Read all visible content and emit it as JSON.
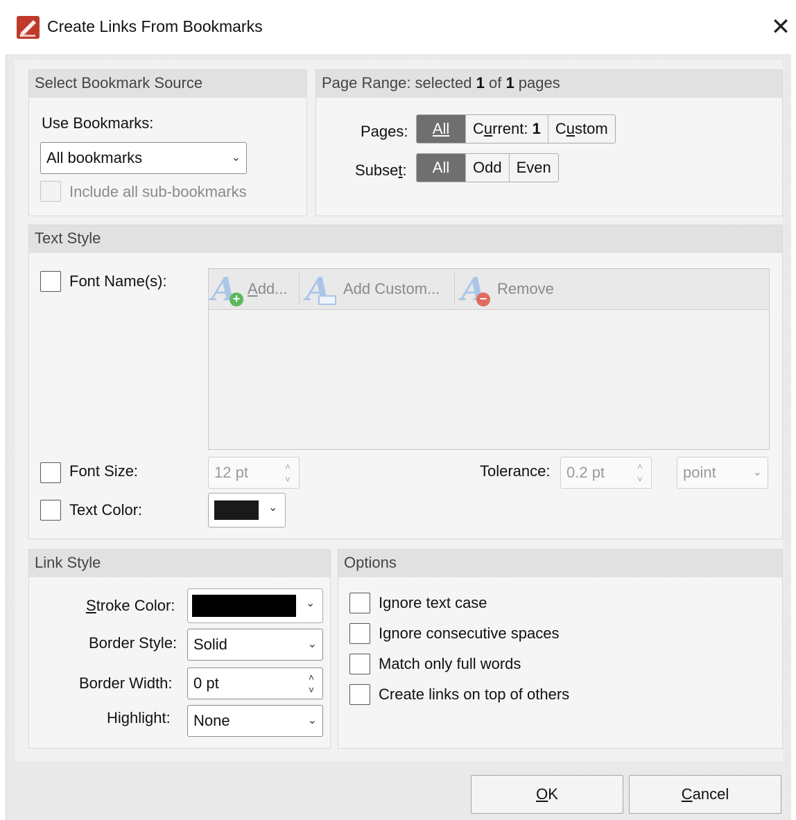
{
  "window": {
    "title": "Create Links From Bookmarks",
    "close_glyph": "✕"
  },
  "bookmark_source": {
    "header": "Select Bookmark Source",
    "use_label": "Use Bookmarks:",
    "select_value": "All bookmarks",
    "include_sub_label": "Include all sub-bookmarks",
    "include_sub_checked": false
  },
  "page_range": {
    "header_prefix": "Page Range: selected ",
    "selected": "1",
    "of_text": " of ",
    "total": "1",
    "header_suffix": " pages",
    "pages_label_a": "Pages",
    "pages_label_b": ":",
    "pages_options": {
      "all": "All",
      "current_prefix": "Current: ",
      "current_num": "1",
      "custom": "Custom"
    },
    "pages_selected": "All",
    "subset_label_a": "Subse",
    "subset_label_u": "t",
    "subset_label_b": ":",
    "subset_options": {
      "all": "All",
      "odd": "Odd",
      "even": "Even"
    },
    "subset_selected": "All"
  },
  "text_style": {
    "header": "Text Style",
    "font_names_label": "Font Name(s):",
    "toolbar": {
      "add": "Add...",
      "add_custom": "Add Custom...",
      "remove": "Remove"
    },
    "font_size_label": "Font Size:",
    "font_size_value": "12 pt",
    "tolerance_label": "Tolerance:",
    "tolerance_value": "0.2 pt",
    "unit_value": "point",
    "text_color_label": "Text Color:",
    "text_color": "#1a1a1a"
  },
  "link_style": {
    "header": "Link Style",
    "stroke_label": "Stroke Color:",
    "stroke_color": "#000000",
    "border_style_label": "Border Style:",
    "border_style_value": "Solid",
    "border_width_label": "Border Width:",
    "border_width_value": "0 pt",
    "highlight_label": "Highlight:",
    "highlight_value": "None"
  },
  "options": {
    "header": "Options",
    "items": [
      {
        "label": "Ignore text case",
        "checked": false
      },
      {
        "label": "Ignore consecutive spaces",
        "checked": false
      },
      {
        "label": "Match only full words",
        "checked": false
      },
      {
        "label": "Create links on top of others",
        "checked": false
      }
    ]
  },
  "buttons": {
    "ok": "OK",
    "cancel": "Cancel"
  },
  "colors": {
    "active_segment": "#6f6f6f",
    "icon_blue": "#a9c6e8",
    "add_green": "#5cb85c",
    "remove_red": "#e06b5f"
  }
}
